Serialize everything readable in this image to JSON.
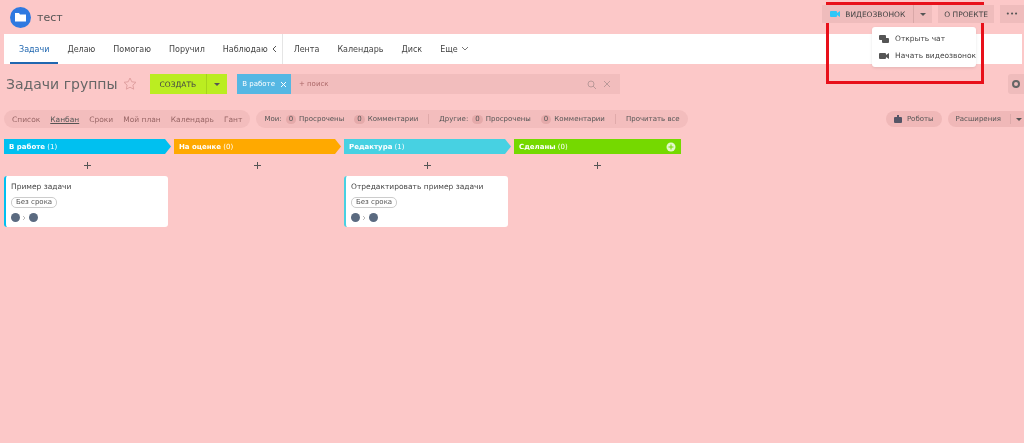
{
  "header": {
    "title": "тест",
    "video_button": {
      "label": "ВИДЕОЗВОНОК"
    },
    "about_button": {
      "label": "О ПРОЕКТЕ"
    },
    "more_button": {
      "label": "•••"
    },
    "menu": {
      "items": [
        {
          "label": "Открыть чат",
          "kind": "chat"
        },
        {
          "label": "Начать видеозвонок",
          "kind": "video"
        }
      ]
    }
  },
  "tabs": [
    {
      "label": "Задачи",
      "selected": true
    },
    {
      "label": "Делаю",
      "selected": false
    },
    {
      "label": "Помогаю",
      "selected": false
    },
    {
      "label": "Поручил",
      "selected": false
    },
    {
      "label": "Наблюдаю",
      "selected": false
    },
    {
      "label": "Лента",
      "selected": false
    },
    {
      "label": "Календарь",
      "selected": false
    },
    {
      "label": "Диск",
      "selected": false
    },
    {
      "label": "Еще",
      "selected": false
    }
  ],
  "toolbar": {
    "title": "Задачи группы",
    "create_button": "СОЗДАТЬ",
    "filter_tag": "В работе",
    "search_placeholder": "+ поиск"
  },
  "views": [
    {
      "label": "Список",
      "selected": false
    },
    {
      "label": "Канбан",
      "selected": true
    },
    {
      "label": "Сроки",
      "selected": false
    },
    {
      "label": "Мой план",
      "selected": false
    },
    {
      "label": "Календарь",
      "selected": false
    },
    {
      "label": "Гант",
      "selected": false
    }
  ],
  "counters": [
    {
      "label": "Мои:",
      "items": [
        {
          "count": "0",
          "label": "Просрочены"
        },
        {
          "count": "0",
          "label": "Комментарии"
        }
      ]
    },
    {
      "label": "Другие:",
      "items": [
        {
          "count": "0",
          "label": "Просрочены"
        },
        {
          "count": "0",
          "label": "Комментарии"
        }
      ]
    }
  ],
  "read_all": "Прочитать все",
  "robots_button": "Роботы",
  "extensions_button": "Расширения",
  "columns": [
    {
      "title": "В работе",
      "count": "(1)",
      "color": "#00c0f0",
      "cards": [
        {
          "title": "Пример задачи",
          "deadline": "Без срока"
        }
      ]
    },
    {
      "title": "На оценке",
      "count": "(0)",
      "color": "#ffa900"
    },
    {
      "title": "Редактура",
      "count": "(1)",
      "color": "#47d1e2",
      "cards": [
        {
          "title": "Отредактировать пример задачи",
          "deadline": "Без срока"
        }
      ]
    },
    {
      "title": "Сделаны",
      "count": "(0)",
      "color": "#75d900"
    }
  ]
}
